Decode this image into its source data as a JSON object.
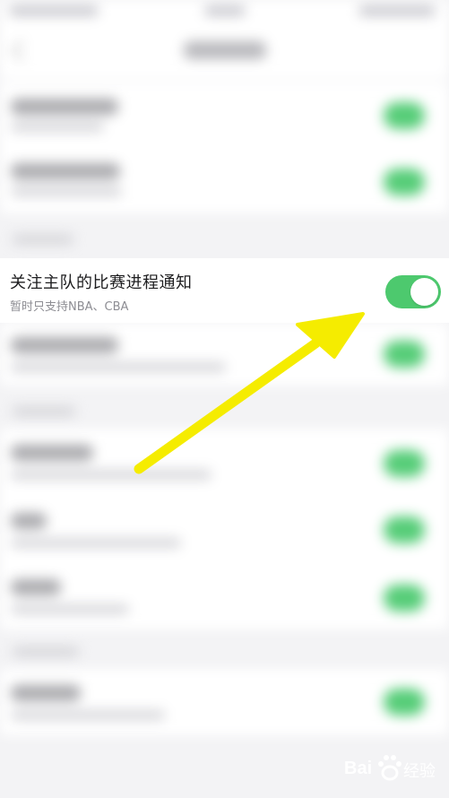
{
  "setting": {
    "title": "关注主队的比赛进程通知",
    "subtitle": "暂时只支持NBA、CBA",
    "toggle_on": true
  },
  "watermark": {
    "logo_text": "Bai",
    "logo_suffix": "经验",
    "icon": "paw-icon"
  },
  "colors": {
    "toggle_on": "#4dc96e",
    "arrow": "#f5ec00",
    "background": "#f3f3f5"
  }
}
